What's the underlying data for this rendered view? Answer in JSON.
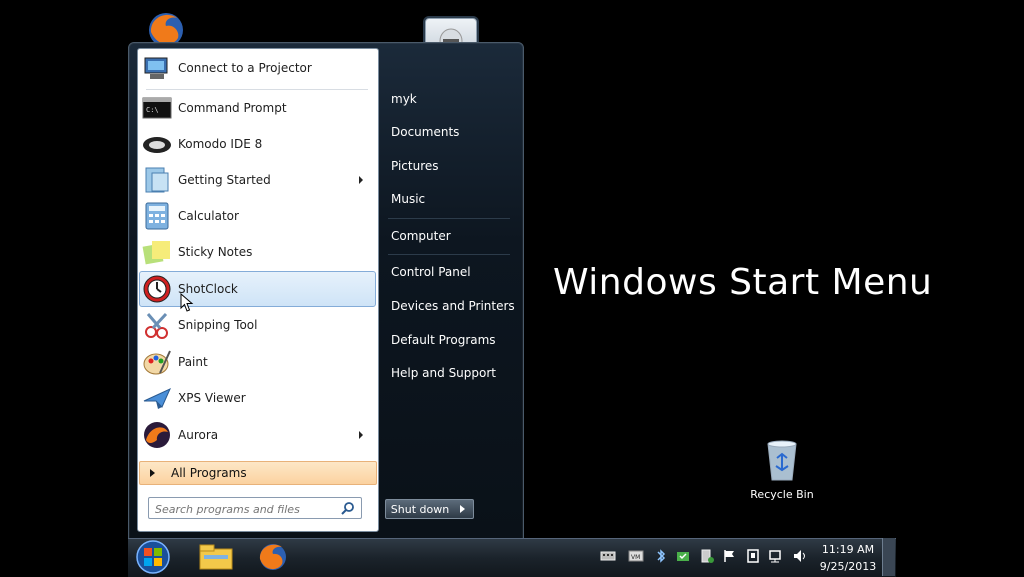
{
  "headline": "Windows Start Menu",
  "start_menu": {
    "programs": [
      {
        "label": "Connect to a Projector",
        "icon": "projector-icon"
      },
      {
        "label": "Command Prompt",
        "icon": "command-prompt-icon"
      },
      {
        "label": "Komodo IDE 8",
        "icon": "komodo-icon"
      },
      {
        "label": "Getting Started",
        "icon": "getting-started-icon",
        "submenu": true
      },
      {
        "label": "Calculator",
        "icon": "calculator-icon"
      },
      {
        "label": "Sticky Notes",
        "icon": "sticky-notes-icon"
      },
      {
        "label": "ShotClock",
        "icon": "shotclock-icon",
        "highlighted": true
      },
      {
        "label": "Snipping Tool",
        "icon": "snipping-tool-icon"
      },
      {
        "label": "Paint",
        "icon": "paint-icon"
      },
      {
        "label": "XPS Viewer",
        "icon": "xps-viewer-icon"
      },
      {
        "label": "Aurora",
        "icon": "aurora-icon",
        "submenu": true
      }
    ],
    "all_programs": "All Programs",
    "search_placeholder": "Search programs and files",
    "right_items": [
      "myk",
      "Documents",
      "Pictures",
      "Music",
      "Computer",
      "Control Panel",
      "Devices and Printers",
      "Default Programs",
      "Help and Support"
    ],
    "shutdown_label": "Shut down"
  },
  "desktop": {
    "recycle_bin_label": "Recycle Bin"
  },
  "taskbar": {
    "pinned": [
      "explorer-icon",
      "firefox-icon"
    ],
    "tray_icons": [
      "keyboard-icon",
      "vm-icon",
      "bluetooth-icon",
      "sync-icon",
      "usb-icon",
      "flag-icon",
      "device-icon",
      "network-icon",
      "volume-icon"
    ],
    "time": "11:19 AM",
    "date": "9/25/2013"
  },
  "colors": {
    "accent": "#84acd8",
    "highlight": "#cfe4f7",
    "all_programs": "#fbd2a0"
  }
}
